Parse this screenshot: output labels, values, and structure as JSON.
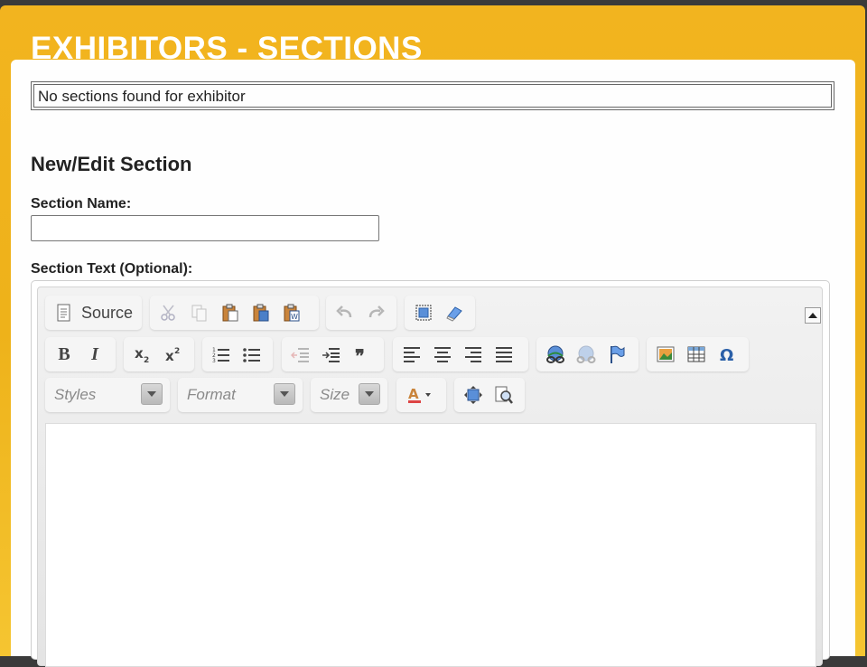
{
  "page": {
    "title": "EXHIBITORS - SECTIONS"
  },
  "sections_table": {
    "empty_message": "No sections found for exhibitor"
  },
  "form": {
    "heading": "New/Edit Section",
    "section_name_label": "Section Name:",
    "section_name_value": "",
    "section_text_label": "Section Text (Optional):"
  },
  "editor": {
    "source_label": "Source",
    "bold_label": "B",
    "italic_label": "I",
    "styles_placeholder": "Styles",
    "format_placeholder": "Format",
    "size_placeholder": "Size",
    "content": ""
  },
  "colors": {
    "header_bg": "#F0B21A",
    "title_text": "#FFFFFF",
    "panel_bg": "#FEFEFE",
    "toolbar_bg": "#E8E8E8"
  }
}
